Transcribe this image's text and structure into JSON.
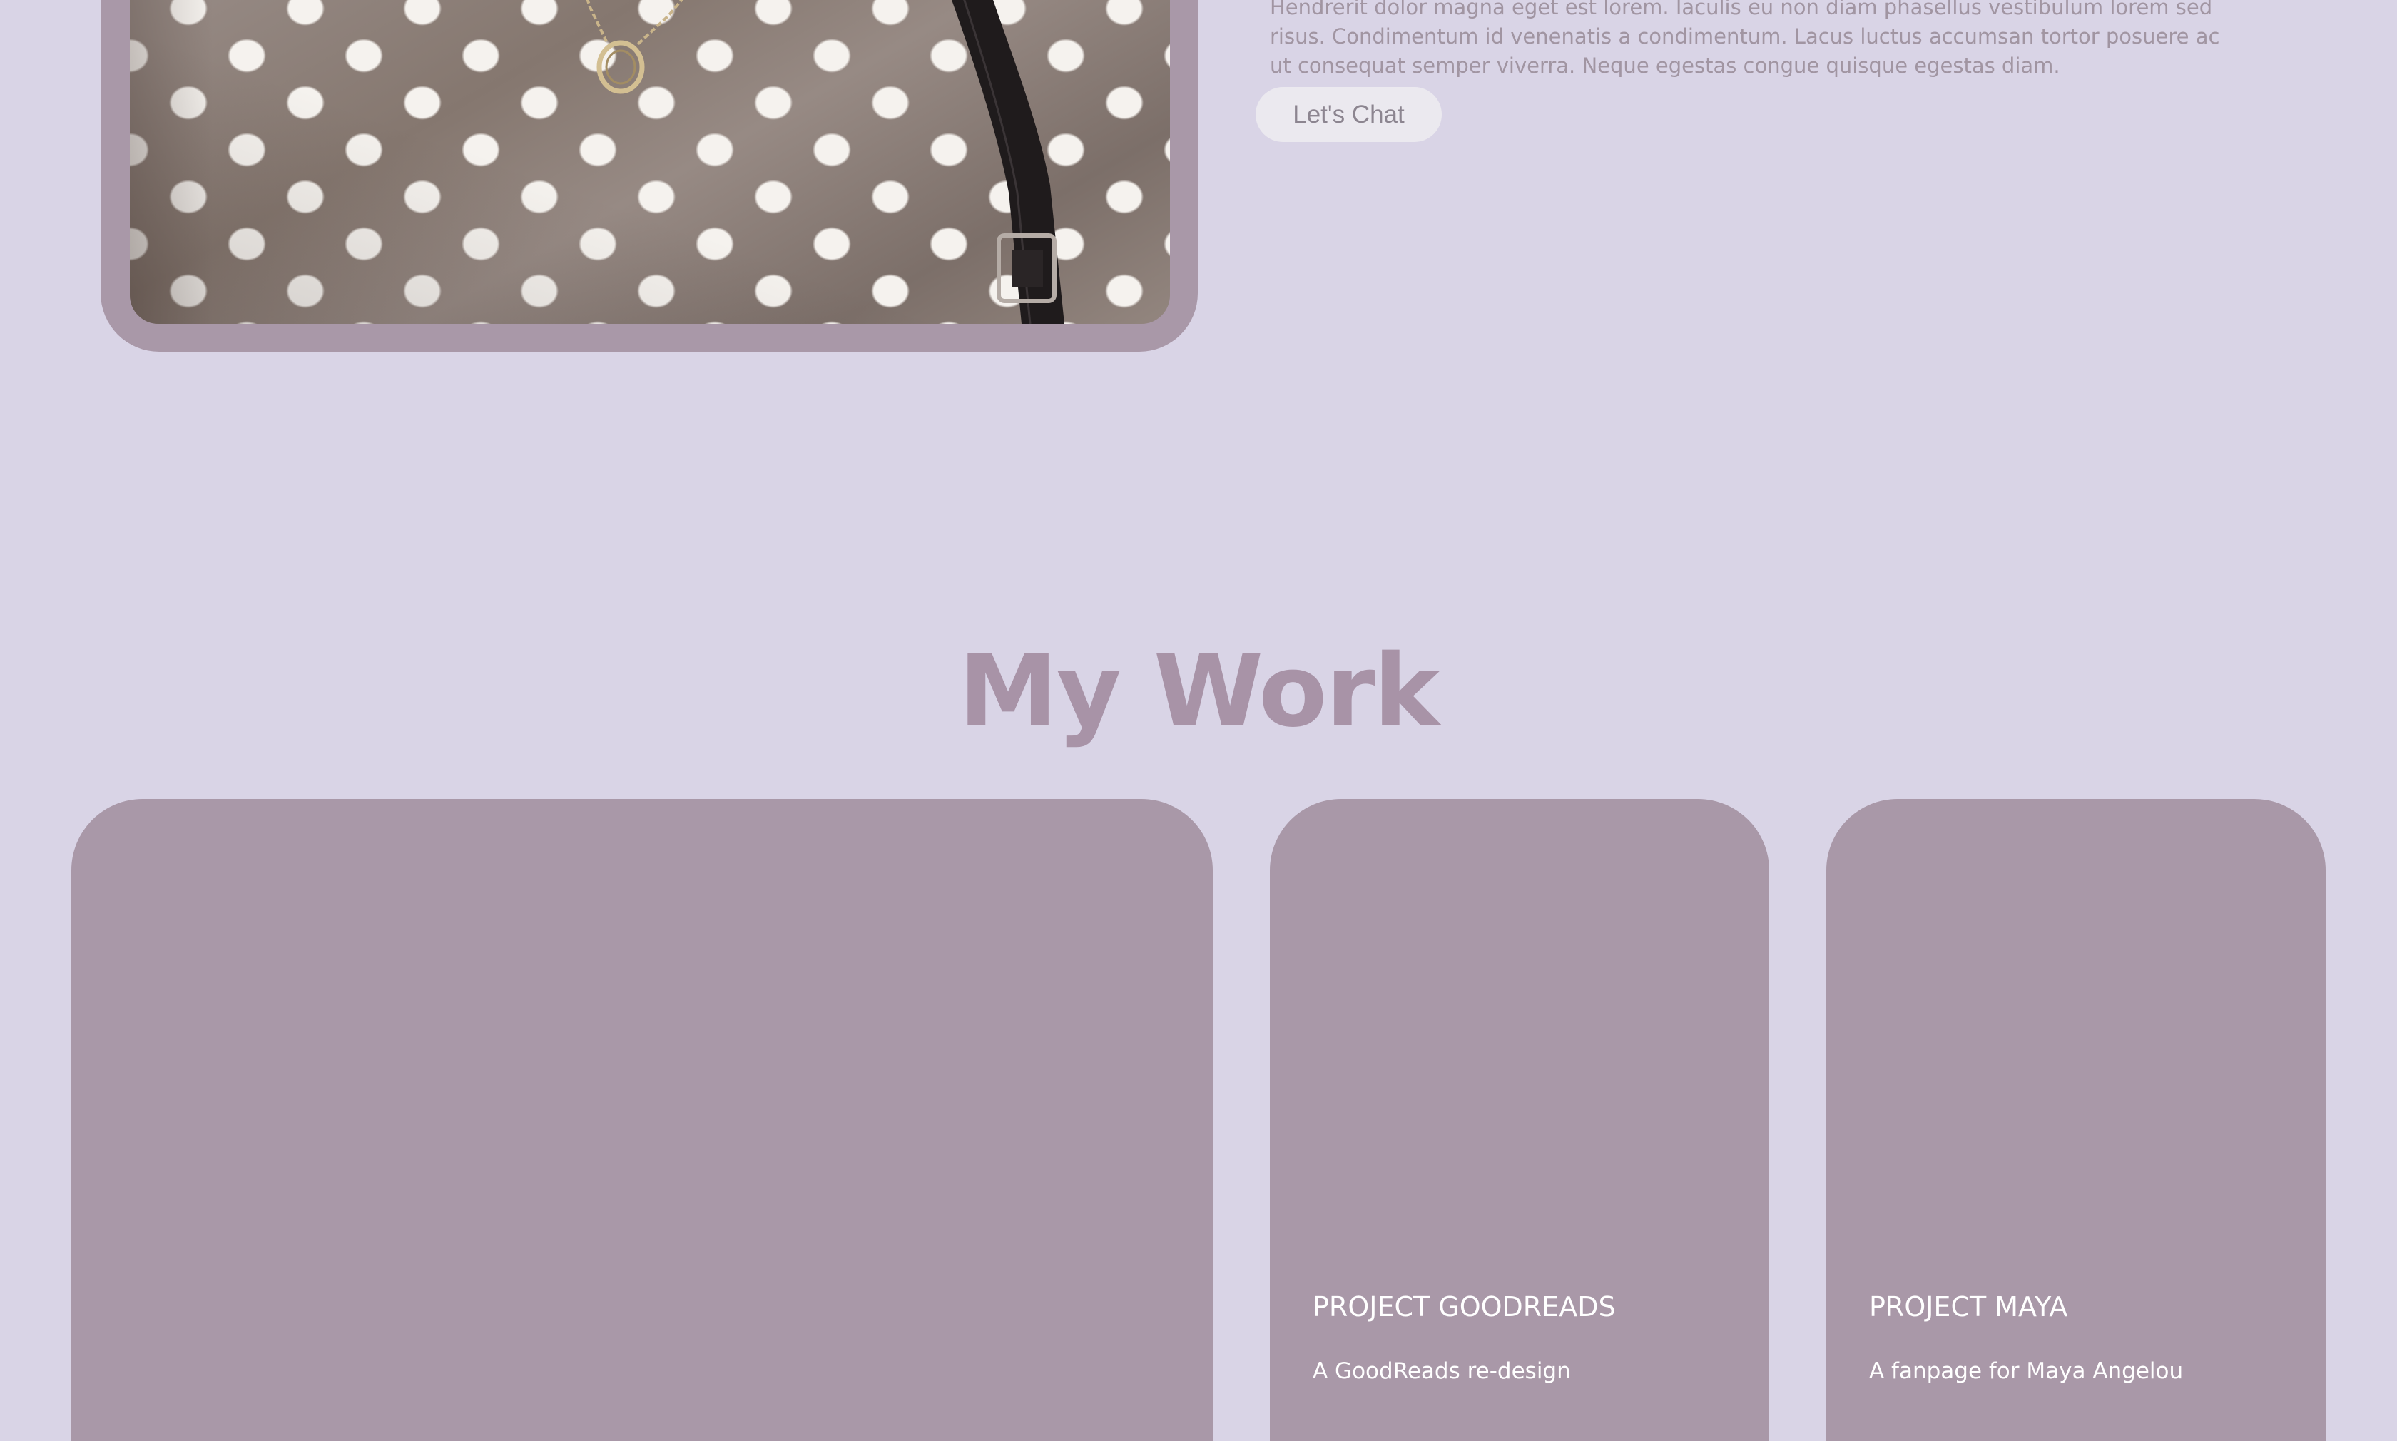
{
  "about": {
    "paragraph": "Hendrerit dolor magna eget est lorem. Iaculis eu non diam phasellus vestibulum lorem sed risus. Condimentum id venenatis a condimentum. Lacus luctus accumsan tortor posuere ac ut consequat semper viverra. Neque egestas congue quisque egestas diam.",
    "cta_label": "Let's Chat"
  },
  "work": {
    "title": "My Work",
    "projects": [
      {
        "title": "",
        "description": ""
      },
      {
        "title": "PROJECT GOODREADS",
        "description": "A GoodReads re-design"
      },
      {
        "title": "PROJECT MAYA",
        "description": "A fanpage for Maya Angelou"
      }
    ]
  },
  "colors": {
    "background": "#d9d4e6",
    "card": "#a998a8",
    "heading": "#a893a7",
    "body_text": "#a195a2",
    "button_bg": "#ebe9ef"
  }
}
